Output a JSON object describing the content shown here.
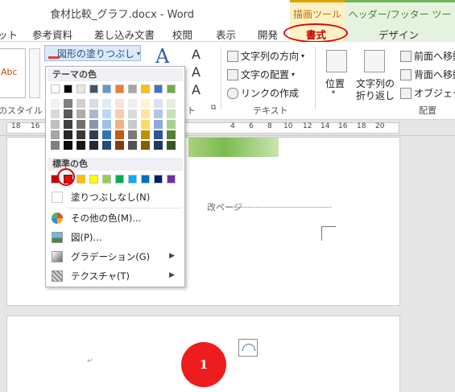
{
  "window": {
    "title": "食材比較_グラフ.docx - Word"
  },
  "contextual": {
    "drawing_tools": "描画ツール",
    "header_footer_tools": "ヘッダー/フッター ツール"
  },
  "tabs": [
    {
      "label": "ット"
    },
    {
      "label": "参考資料"
    },
    {
      "label": "差し込み文書"
    },
    {
      "label": "校閲"
    },
    {
      "label": "表示"
    },
    {
      "label": "開発"
    },
    {
      "label": "書式"
    },
    {
      "label": "デザイン"
    }
  ],
  "ribbon": {
    "style_sample": "Abc",
    "shape_styles_label": "のスタイル",
    "fill_button": "図形の塗りつぶし",
    "text_direction": "文字列の方向",
    "text_align": "文字の配置",
    "create_link": "リンクの作成",
    "text_group_label": "テキスト",
    "position": "位置",
    "wrap_text_1": "文字列の",
    "wrap_text_2": "折り返し",
    "bring_forward": "前面へ移動",
    "send_backward": "背面へ移動",
    "selection_pane": "オブジェクト",
    "arrange_group_label": "配置",
    "wordart_label": "ト"
  },
  "ruler": {
    "numbers": [
      "18",
      "16",
      "4",
      "6",
      "8",
      "10",
      "12",
      "14",
      "16",
      "18",
      "20"
    ]
  },
  "dropdown": {
    "theme_colors_header": "テーマの色",
    "standard_colors_header": "標準の色",
    "no_fill": "塗りつぶしなし(N)",
    "more_colors": "その他の色(M)...",
    "picture": "図(P)...",
    "gradient": "グラデーション(G)",
    "texture": "テクスチャ(T)",
    "theme_top_row": [
      "#ffffff",
      "#000000",
      "#e7e6e6",
      "#44546a",
      "#5b9bd5",
      "#ed7d31",
      "#a5a5a5",
      "#ffc000",
      "#4472c4",
      "#70ad47"
    ],
    "theme_shades": [
      [
        "#f2f2f2",
        "#7f7f7f",
        "#d0cece",
        "#d6dce4",
        "#deebf6",
        "#fbe4d5",
        "#ededed",
        "#fff2cc",
        "#dae3f3",
        "#e2efd9"
      ],
      [
        "#d8d8d8",
        "#595959",
        "#aeabab",
        "#adb9ca",
        "#bdd7ee",
        "#f7cbac",
        "#dbdbdb",
        "#fee599",
        "#b4c6e7",
        "#c5e0b3"
      ],
      [
        "#bfbfbf",
        "#3f3f3f",
        "#757070",
        "#8496b0",
        "#9cc3e5",
        "#f4b183",
        "#c9c9c9",
        "#ffd965",
        "#8eaadb",
        "#a8d08d"
      ],
      [
        "#a5a5a5",
        "#262626",
        "#3a3838",
        "#323f4f",
        "#2e75b5",
        "#c55a11",
        "#7b7b7b",
        "#bf9000",
        "#2f5496",
        "#538135"
      ],
      [
        "#7f7f7f",
        "#0c0c0c",
        "#171616",
        "#222a35",
        "#1e4e79",
        "#843c0b",
        "#525252",
        "#7f6000",
        "#1f3864",
        "#375623"
      ]
    ],
    "standard_colors": [
      "#c00000",
      "#ff0000",
      "#ffc000",
      "#ffff00",
      "#92d050",
      "#00b050",
      "#00b0f0",
      "#0070c0",
      "#002060",
      "#7030a0"
    ],
    "selected_standard_color": "#ff0000"
  },
  "document": {
    "page_break": "改ページ",
    "badge_number": "1"
  }
}
